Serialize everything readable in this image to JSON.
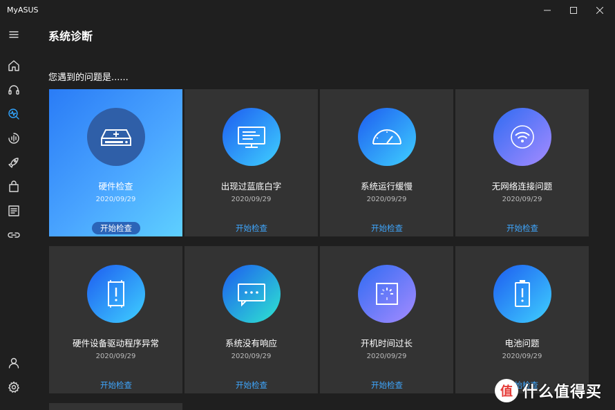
{
  "app": {
    "title": "MyASUS"
  },
  "window_controls": [
    {
      "name": "minimize",
      "symbol": "—"
    },
    {
      "name": "maximize",
      "symbol": "☐"
    },
    {
      "name": "close",
      "symbol": "✕"
    }
  ],
  "sidebar": {
    "items": [
      {
        "icon": "menu-icon"
      },
      {
        "icon": "home-icon"
      },
      {
        "icon": "headset-icon"
      },
      {
        "icon": "diagnosis-icon",
        "active": true
      },
      {
        "icon": "audio-wizard-icon"
      },
      {
        "icon": "rocket-icon"
      },
      {
        "icon": "shopping-bag-icon"
      },
      {
        "icon": "news-icon"
      },
      {
        "icon": "link-icon"
      },
      {
        "icon": "user-icon"
      },
      {
        "icon": "settings-icon"
      }
    ]
  },
  "page": {
    "title": "系统诊断",
    "question": "您遇到的问题是......"
  },
  "cards": [
    {
      "title": "硬件检查",
      "date": "2020/09/29",
      "button": "开始检查",
      "icon": "hard-drive-icon",
      "selected": true
    },
    {
      "title": "出现过蓝底白字",
      "date": "2020/09/29",
      "button": "开始检查",
      "icon": "monitor-icon"
    },
    {
      "title": "系统运行缓慢",
      "date": "2020/09/29",
      "button": "开始检查",
      "icon": "speedometer-icon"
    },
    {
      "title": "无网络连接问题",
      "date": "2020/09/29",
      "button": "开始检查",
      "icon": "wifi-icon"
    },
    {
      "title": "硬件设备驱动程序异常",
      "date": "2020/09/29",
      "button": "开始检查",
      "icon": "chip-warning-icon"
    },
    {
      "title": "系统没有响应",
      "date": "2020/09/29",
      "button": "开始检查",
      "icon": "chat-bubble-icon"
    },
    {
      "title": "开机时间过长",
      "date": "2020/09/29",
      "button": "开始检查",
      "icon": "loading-icon"
    },
    {
      "title": "电池问题",
      "date": "2020/09/29",
      "button": "开始检查",
      "icon": "battery-warning-icon"
    }
  ],
  "colors": {
    "accent": "#31a4ff",
    "card_bg": "#333333",
    "app_bg": "#1f1f1f"
  },
  "watermark": {
    "logo": "值",
    "text": "什么值得买"
  }
}
